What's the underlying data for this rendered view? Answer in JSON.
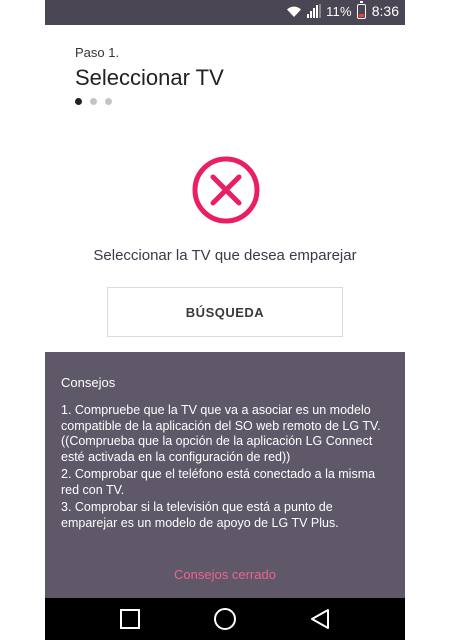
{
  "status_bar": {
    "battery_percent_text": "11%",
    "time": "8:36",
    "icons": [
      "wifi-icon",
      "signal-icon",
      "battery-icon"
    ]
  },
  "wizard": {
    "step_label": "Paso 1.",
    "step_title": "Seleccionar TV",
    "total_steps": 3,
    "current_step": 1
  },
  "status_icon": {
    "name": "error-icon",
    "color": "#e91e63"
  },
  "instruction": "Seleccionar la TV que desea emparejar",
  "search_button_label": "BÚSQUEDA",
  "tips": {
    "title": "Consejos",
    "items": [
      "1. Compruebe que la TV que va a asociar es un modelo compatible de la aplicación del SO web remoto de LG TV.((Comprueba que la opción de la aplicación LG Connect esté activada en la configuración de red))",
      "2. Comprobar que el teléfono está conectado a la misma red con TV.",
      "3. Comprobar si la televisión que está a punto de emparejar es un modelo de apoyo de LG TV Plus."
    ],
    "close_label": "Consejos cerrado"
  },
  "colors": {
    "status_bar": "#4a4654",
    "tips_panel": "#5e5868",
    "accent_pink": "#f06292",
    "error_red": "#e91e63"
  }
}
